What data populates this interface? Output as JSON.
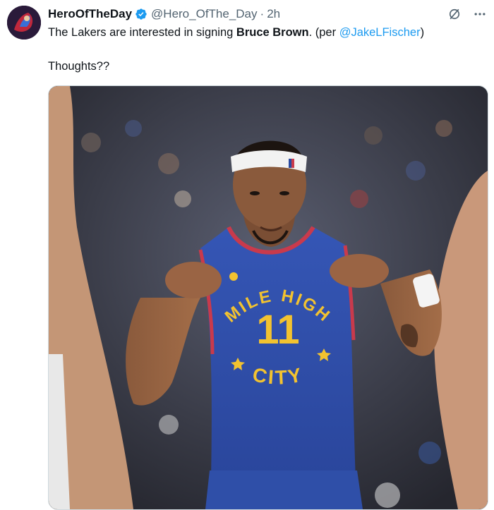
{
  "author": {
    "display_name": "HeroOfTheDay",
    "handle": "@Hero_OfThe_Day",
    "separator": "·",
    "time": "2h"
  },
  "tweet": {
    "text_before": "The Lakers are interested in signing ",
    "bold_text": "Bruce Brown",
    "text_middle": ". (per ",
    "mention": "@JakeLFischer",
    "text_end": ")",
    "second_line": "Thoughts??"
  },
  "jersey": {
    "top_text": "MILE HIGH",
    "number": "11",
    "bottom_text": "CITY"
  },
  "headband_logo": "NBA",
  "colors": {
    "accent": "#1d9bf0",
    "jersey_blue": "#2c4ea8",
    "jersey_gold": "#f2c230"
  },
  "icons": [
    "verified-badge-icon",
    "grok-icon",
    "more-icon"
  ]
}
